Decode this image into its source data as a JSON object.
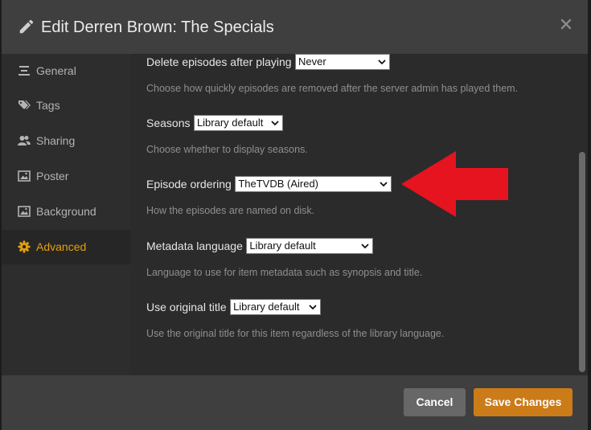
{
  "header": {
    "title": "Edit Derren Brown: The Specials"
  },
  "sidebar": {
    "items": [
      {
        "label": "General",
        "icon": "general-lines-icon",
        "active": false
      },
      {
        "label": "Tags",
        "icon": "tags-icon",
        "active": false
      },
      {
        "label": "Sharing",
        "icon": "users-icon",
        "active": false
      },
      {
        "label": "Poster",
        "icon": "image-icon",
        "active": false
      },
      {
        "label": "Background",
        "icon": "image-icon",
        "active": false
      },
      {
        "label": "Advanced",
        "icon": "gear-icon",
        "active": true
      }
    ]
  },
  "settings": {
    "delete_episodes": {
      "label": "Delete episodes after playing",
      "value": "Never",
      "help": "Choose how quickly episodes are removed after the server admin has played them."
    },
    "seasons": {
      "label": "Seasons",
      "value": "Library default",
      "help": "Choose whether to display seasons."
    },
    "episode_ordering": {
      "label": "Episode ordering",
      "value": "TheTVDB (Aired)",
      "help": "How the episodes are named on disk."
    },
    "metadata_language": {
      "label": "Metadata language",
      "value": "Library default",
      "help": "Language to use for item metadata such as synopsis and title."
    },
    "original_title": {
      "label": "Use original title",
      "value": "Library default",
      "help": "Use the original title for this item regardless of the library language."
    }
  },
  "footer": {
    "cancel_label": "Cancel",
    "save_label": "Save Changes"
  },
  "colors": {
    "accent": "#e5a00d",
    "save_button": "#cc7b19",
    "annotation_arrow": "#e5141f"
  }
}
